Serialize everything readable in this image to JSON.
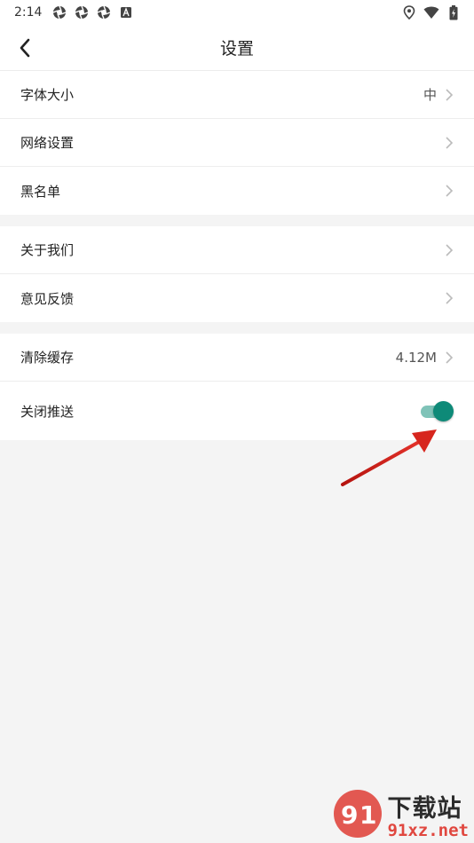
{
  "status_bar": {
    "time": "2:14",
    "left_icons": [
      "aperture-icon",
      "aperture-icon",
      "aperture-icon",
      "a-badge-icon"
    ],
    "right_icons": [
      "location-icon",
      "wifi-icon",
      "battery-icon"
    ]
  },
  "header": {
    "title": "设置",
    "back_icon": "chevron-left-icon"
  },
  "groups": [
    {
      "items": [
        {
          "label": "字体大小",
          "value": "中"
        },
        {
          "label": "网络设置",
          "value": ""
        },
        {
          "label": "黑名单",
          "value": ""
        }
      ]
    },
    {
      "items": [
        {
          "label": "关于我们",
          "value": ""
        },
        {
          "label": "意见反馈",
          "value": ""
        }
      ]
    },
    {
      "items": [
        {
          "label": "清除缓存",
          "value": "4.12M"
        },
        {
          "label": "关闭推送",
          "toggle": true
        }
      ]
    }
  ],
  "colors": {
    "accent": "#0e8a78",
    "toggle_track": "#7fc3b8",
    "annotation_arrow": "#d7261e"
  },
  "watermark": {
    "brand_cn": "下载站",
    "brand_url": "91xz.net"
  }
}
